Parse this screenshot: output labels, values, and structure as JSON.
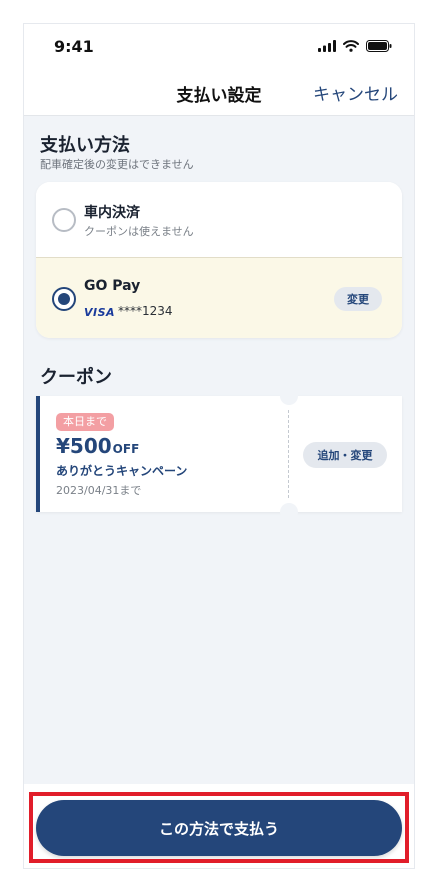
{
  "status_bar": {
    "time": "9:41",
    "icons": [
      "cellular-signal-icon",
      "wifi-icon",
      "battery-icon"
    ]
  },
  "header": {
    "title": "支払い設定",
    "cancel_label": "キャンセル"
  },
  "payment_method": {
    "title": "支払い方法",
    "subtitle": "配車確定後の変更はできません",
    "options": [
      {
        "label": "車内決済",
        "sub": "クーポンは使えません",
        "selected": false
      },
      {
        "label": "GO Pay",
        "card_brand": "VISA",
        "card_number": "****1234",
        "change_label": "変更",
        "selected": true
      }
    ]
  },
  "coupon": {
    "title": "クーポン",
    "badge": "本日まで",
    "amount": "¥500",
    "amount_suffix": "OFF",
    "name": "ありがとうキャンペーン",
    "expiry": "2023/04/31まで",
    "button_label": "追加・変更"
  },
  "footer": {
    "pay_button_label": "この方法で支払う"
  },
  "colors": {
    "primary": "#24467a",
    "background": "#f1f4f8",
    "selected_option_bg": "#fbf8e7",
    "badge": "#f39fa3",
    "highlight": "#e11d2a"
  }
}
